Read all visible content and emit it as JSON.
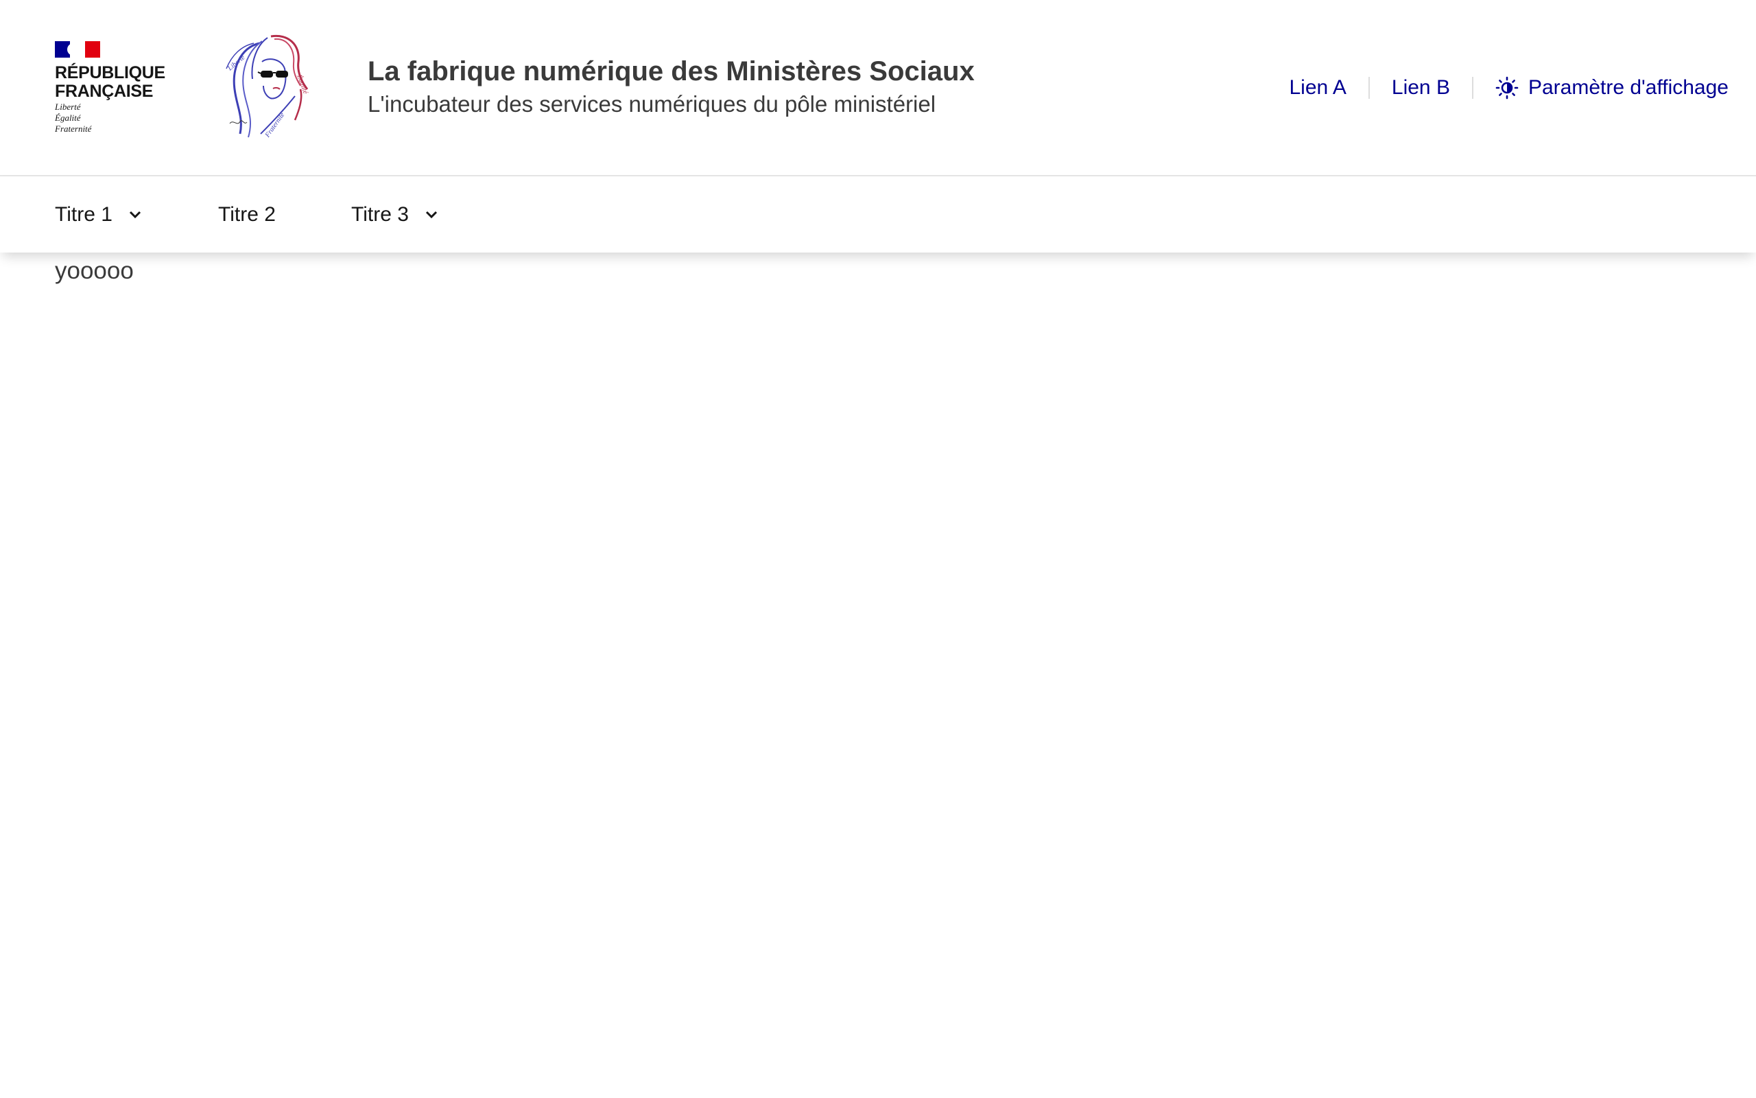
{
  "header": {
    "republique": {
      "line1": "RÉPUBLIQUE",
      "line2": "FRANÇAISE",
      "motto": [
        "Liberté",
        "Égalité",
        "Fraternité"
      ]
    },
    "service_title": "La fabrique numérique des Ministères Sociaux",
    "service_tagline": "L'incubateur des services numériques du pôle ministériel",
    "tools": [
      {
        "label": "Lien A"
      },
      {
        "label": "Lien B"
      },
      {
        "label": "Paramètre d'affichage",
        "icon": "sun-icon"
      }
    ]
  },
  "nav": {
    "items": [
      {
        "label": "Titre 1",
        "has_dropdown": true
      },
      {
        "label": "Titre 2",
        "has_dropdown": false
      },
      {
        "label": "Titre 3",
        "has_dropdown": true
      }
    ]
  },
  "content": {
    "text": "yooooo"
  },
  "colors": {
    "primary_blue": "#000091",
    "flag_red": "#e1000f",
    "text": "#3a3a3a",
    "marianne_red": "#b52d4a",
    "marianne_blue": "#3d3fb5"
  }
}
